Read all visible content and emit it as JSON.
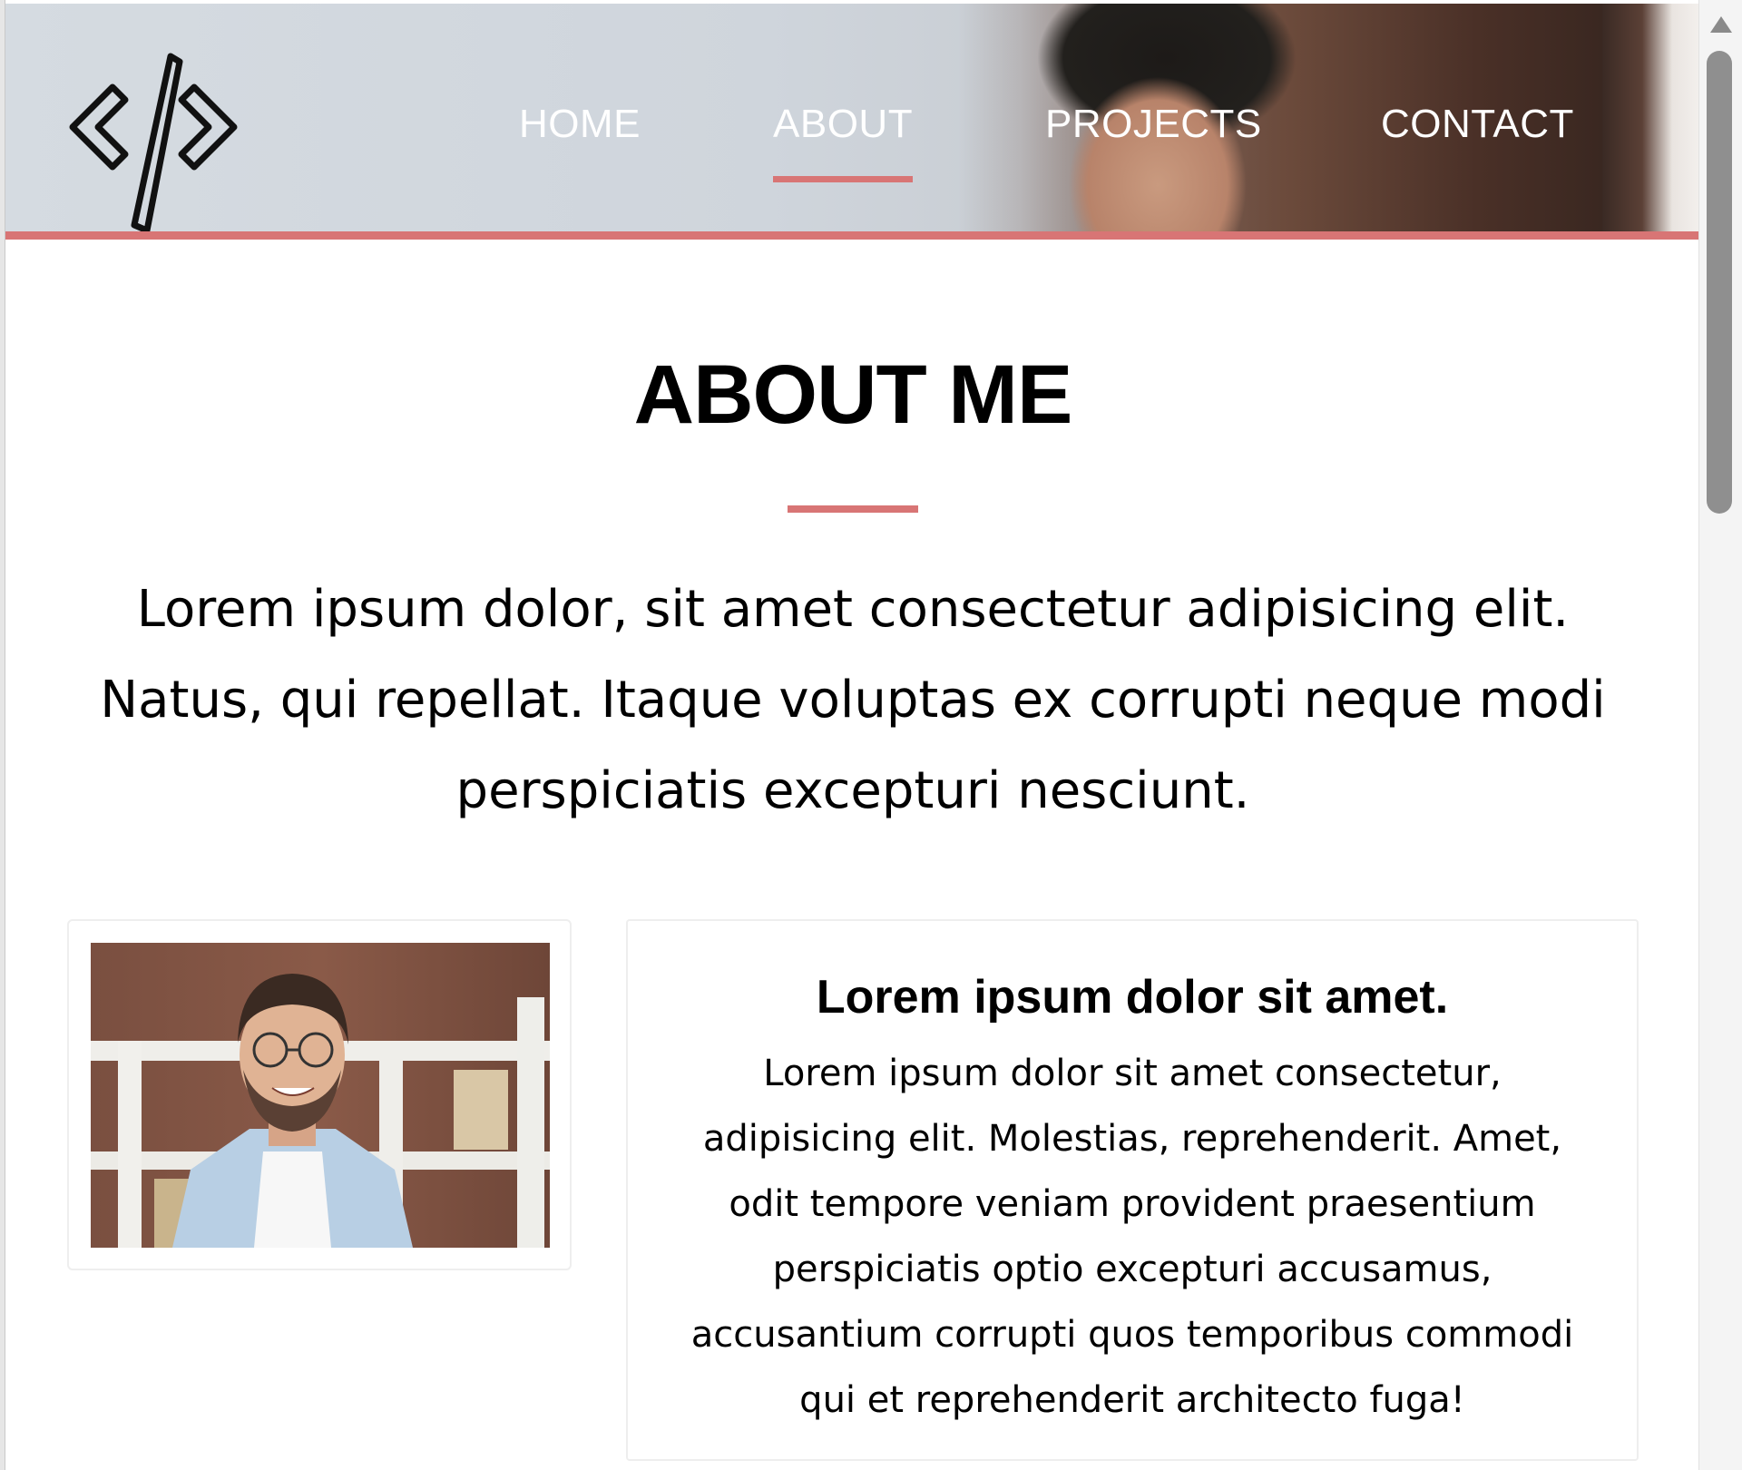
{
  "nav": {
    "logo_icon": "code-brackets-icon",
    "items": [
      {
        "label": "HOME",
        "active": false
      },
      {
        "label": "ABOUT",
        "active": true
      },
      {
        "label": "PROJECTS",
        "active": false
      },
      {
        "label": "CONTACT",
        "active": false
      }
    ]
  },
  "about": {
    "title": "ABOUT ME",
    "intro": "Lorem ipsum dolor, sit amet consectetur adipisicing elit. Natus, qui repellat. Itaque voluptas ex corrupti neque modi perspiciatis excepturi nesciunt."
  },
  "card": {
    "heading": "Lorem ipsum dolor sit amet.",
    "body": "Lorem ipsum dolor sit amet consectetur, adipisicing elit. Molestias, reprehenderit. Amet, odit tempore veniam provident praesentium perspiciatis optio excepturi accusamus, accusantium corrupti quos temporibus commodi qui et reprehenderit architecto fuga!"
  },
  "colors": {
    "accent": "#d87575",
    "text": "#000000",
    "nav_text": "#ffffff",
    "card_border": "#eeeeee"
  }
}
